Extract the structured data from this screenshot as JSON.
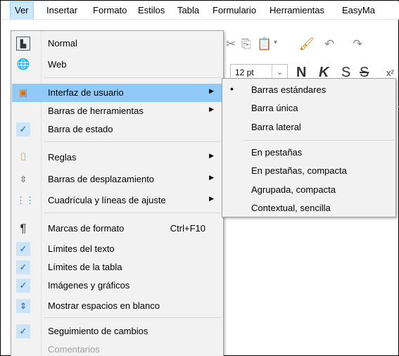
{
  "menubar": {
    "items": [
      "Ver",
      "Insertar",
      "Formato",
      "Estilos",
      "Tabla",
      "Formulario",
      "Herramientas",
      "EasyMa"
    ]
  },
  "toolbar": {
    "font_size": "12 pt",
    "bold": "N",
    "italic": "K",
    "underline": "S",
    "strike": "S",
    "superscript": "x²"
  },
  "ver_menu": {
    "items": [
      {
        "label": "Normal",
        "icon": "page-layout-icon"
      },
      {
        "label": "Web",
        "icon": "globe-icon"
      },
      {
        "label": "Interfaz de usuario",
        "icon": "ui-icon",
        "submenu": true
      },
      {
        "label": "Barras de herramientas",
        "submenu": true
      },
      {
        "label": "Barra de estado",
        "checked": true
      },
      {
        "label": "Reglas",
        "icon": "ruler-icon",
        "submenu": true
      },
      {
        "label": "Barras de desplazamiento",
        "icon": "scrollbar-icon",
        "submenu": true
      },
      {
        "label": "Cuadrícula y líneas de ajuste",
        "icon": "grid-icon",
        "submenu": true
      },
      {
        "label": "Marcas de formato",
        "icon": "pilcrow-icon",
        "shortcut": "Ctrl+F10"
      },
      {
        "label": "Límites del texto",
        "checked": true
      },
      {
        "label": "Límites de la tabla",
        "checked": true
      },
      {
        "label": "Imágenes y gráficos",
        "checked": true
      },
      {
        "label": "Mostrar espacios en blanco",
        "icon": "whitespace-icon"
      },
      {
        "label": "Seguimiento de cambios",
        "checked": true
      },
      {
        "label": "Comentarios",
        "disabled": true
      }
    ]
  },
  "ui_submenu": {
    "items": [
      {
        "label": "Barras estándares",
        "selected": true
      },
      {
        "label": "Barra única"
      },
      {
        "label": "Barra lateral"
      },
      {
        "label": "En pestañas"
      },
      {
        "label": "En pestañas, compacta"
      },
      {
        "label": "Agrupada, compacta"
      },
      {
        "label": "Contextual, sencilla"
      }
    ],
    "bullet": "•"
  },
  "colors": {
    "menu_bg": "#f2f2f2",
    "highlight": "#91c9f7",
    "active_menubar": "#cce8ff",
    "check_bg": "#cce4f7"
  }
}
